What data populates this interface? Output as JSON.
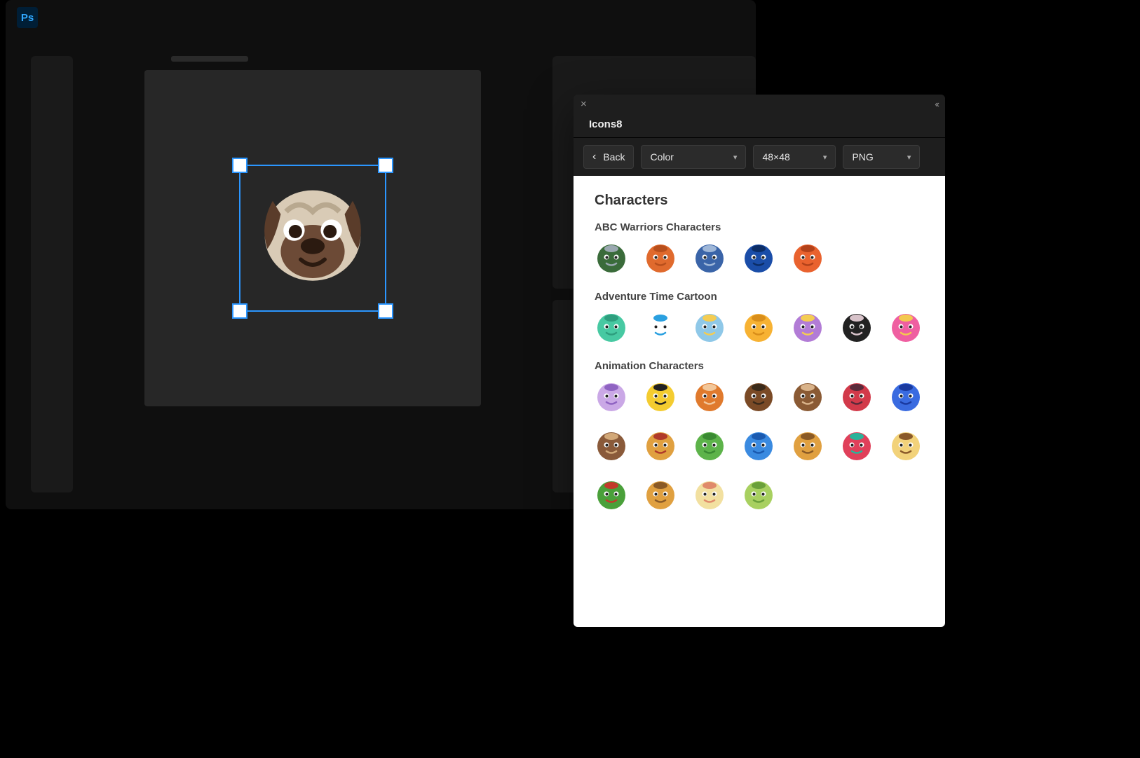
{
  "app": {
    "name": "Ps"
  },
  "panel": {
    "tab_label": "Icons8",
    "back_label": "Back",
    "style_value": "Color",
    "size_value": "48×48",
    "format_value": "PNG",
    "section_title": "Characters",
    "groups": [
      {
        "title": "ABC Warriors Characters",
        "icons": [
          "deadlock",
          "hammerstein",
          "mongrol",
          "joe-pineapples",
          "mek-quake"
        ]
      },
      {
        "title": "Adventure Time Cartoon",
        "icons": [
          "bmo",
          "finn",
          "ice-king",
          "jake",
          "lumpy-space-princess",
          "marceline",
          "princess-bubblegum"
        ]
      },
      {
        "title": "Animation Characters",
        "icons": [
          "amethyst",
          "bill-cipher",
          "brave",
          "captain",
          "cheburashka",
          "garnet",
          "genie",
          "grunkle-stan",
          "heat",
          "kermit",
          "lapis",
          "lion",
          "ariel",
          "morty",
          "ninja-turtle",
          "owl",
          "pearl",
          "peridot"
        ]
      }
    ]
  }
}
